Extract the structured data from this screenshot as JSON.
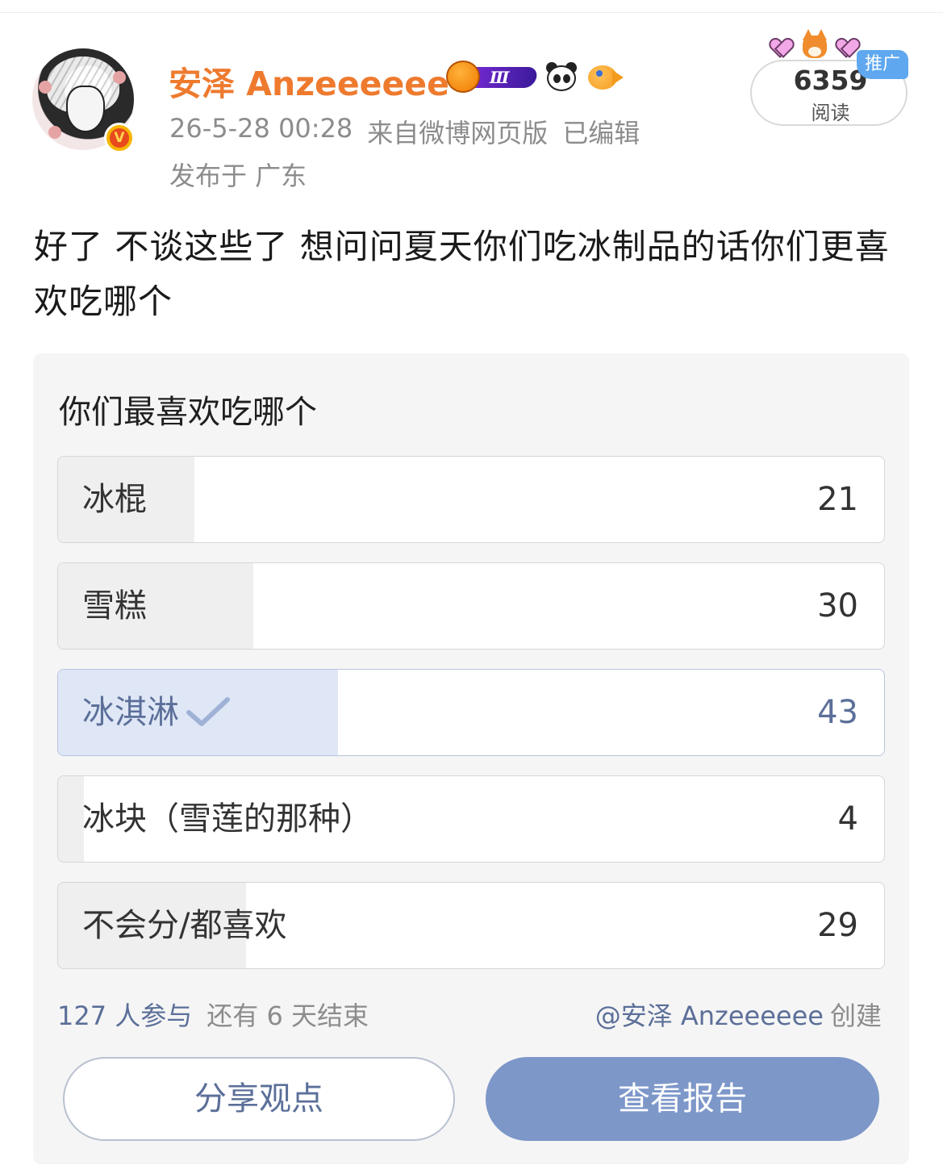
{
  "header": {
    "username": "安泽 Anzeeeeee",
    "level_badge": "Ⅲ",
    "timestamp": "26-5-28 00:28",
    "source": "来自微博网页版",
    "edited": "已编辑",
    "location": "发布于 广东",
    "verified_mark": "V"
  },
  "stats": {
    "read_count": "6359",
    "read_label": "阅读",
    "promo_tag": "推广"
  },
  "post": {
    "text": "好了 不谈这些了 想问问夏天你们吃冰制品的话你们更喜欢吃哪个"
  },
  "poll": {
    "title": "你们最喜欢吃哪个",
    "options": [
      {
        "label": "冰棍",
        "count": "21",
        "fraction": 0.165,
        "selected": false
      },
      {
        "label": "雪糕",
        "count": "30",
        "fraction": 0.236,
        "selected": false
      },
      {
        "label": "冰淇淋",
        "count": "43",
        "fraction": 0.339,
        "selected": true
      },
      {
        "label": "冰块（雪莲的那种）",
        "count": "4",
        "fraction": 0.031,
        "selected": false
      },
      {
        "label": "不会分/都喜欢",
        "count": "29",
        "fraction": 0.228,
        "selected": false
      }
    ],
    "participants": "127 人参与",
    "days_left": "还有 6 天结束",
    "creator_mention": "@安泽 Anzeeeeee",
    "creator_suffix": "创建",
    "share_label": "分享观点",
    "report_label": "查看报告"
  },
  "colors": {
    "username": "#ee7a2e",
    "accent": "#5b6f99",
    "report_button": "#7d97c9",
    "selected_fill": "#dfe7f6"
  }
}
